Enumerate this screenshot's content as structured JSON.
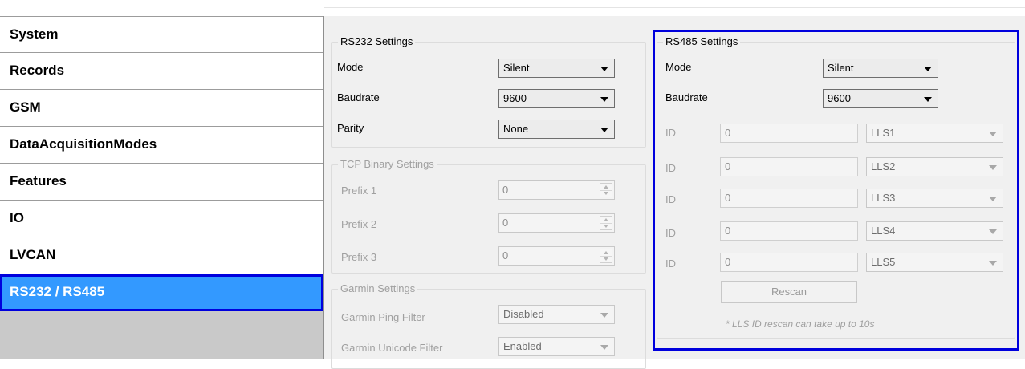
{
  "sidebar": {
    "items": [
      {
        "label": "System"
      },
      {
        "label": "Records"
      },
      {
        "label": "GSM"
      },
      {
        "label": "DataAcquisitionModes"
      },
      {
        "label": "Features"
      },
      {
        "label": "IO"
      },
      {
        "label": "LVCAN"
      },
      {
        "label": "RS232 / RS485",
        "active": true
      }
    ]
  },
  "rs232": {
    "title": "RS232 Settings",
    "mode_label": "Mode",
    "mode_value": "Silent",
    "baud_label": "Baudrate",
    "baud_value": "9600",
    "parity_label": "Parity",
    "parity_value": "None"
  },
  "tcp": {
    "title": "TCP Binary Settings",
    "prefix1_label": "Prefix 1",
    "prefix1_value": "0",
    "prefix2_label": "Prefix 2",
    "prefix2_value": "0",
    "prefix3_label": "Prefix 3",
    "prefix3_value": "0"
  },
  "garmin": {
    "title": "Garmin Settings",
    "ping_label": "Garmin Ping Filter",
    "ping_value": "Disabled",
    "unicode_label": "Garmin Unicode Filter",
    "unicode_value": "Enabled"
  },
  "rs485": {
    "title": "RS485 Settings",
    "mode_label": "Mode",
    "mode_value": "Silent",
    "baud_label": "Baudrate",
    "baud_value": "9600",
    "sensors": [
      {
        "id_label": "ID",
        "id_value": "0",
        "type": "LLS1"
      },
      {
        "id_label": "ID",
        "id_value": "0",
        "type": "LLS2"
      },
      {
        "id_label": "ID",
        "id_value": "0",
        "type": "LLS3"
      },
      {
        "id_label": "ID",
        "id_value": "0",
        "type": "LLS4"
      },
      {
        "id_label": "ID",
        "id_value": "0",
        "type": "LLS5"
      }
    ],
    "rescan_label": "Rescan",
    "note": "* LLS ID rescan can take up to 10s"
  },
  "colors": {
    "active_item_bg": "#3399ff",
    "highlight_border": "#0000dd",
    "panel_bg": "#f0f0f0"
  }
}
